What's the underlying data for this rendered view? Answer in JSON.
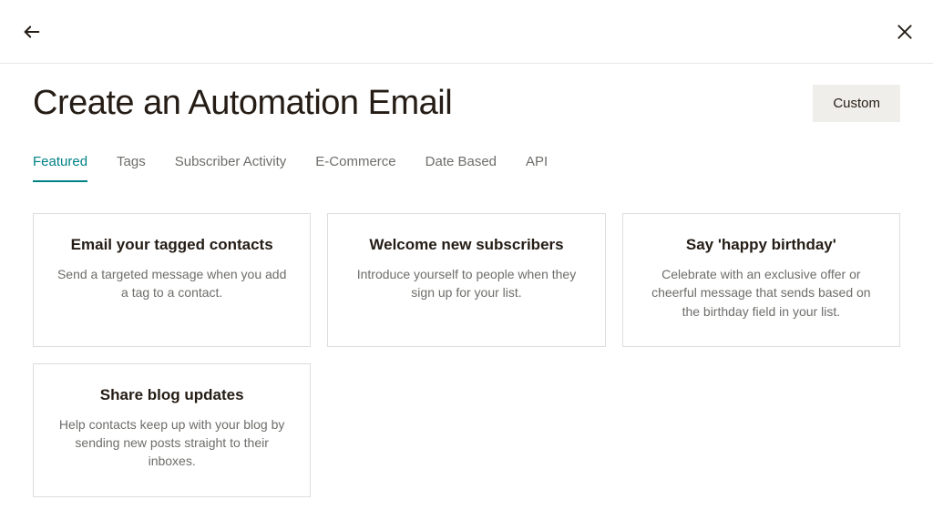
{
  "header": {
    "title": "Create an Automation Email",
    "custom_button": "Custom"
  },
  "tabs": [
    {
      "label": "Featured",
      "active": true
    },
    {
      "label": "Tags",
      "active": false
    },
    {
      "label": "Subscriber Activity",
      "active": false
    },
    {
      "label": "E-Commerce",
      "active": false
    },
    {
      "label": "Date Based",
      "active": false
    },
    {
      "label": "API",
      "active": false
    }
  ],
  "cards": [
    {
      "title": "Email your tagged contacts",
      "description": "Send a targeted message when you add a tag to a contact."
    },
    {
      "title": "Welcome new subscribers",
      "description": "Introduce yourself to people when they sign up for your list."
    },
    {
      "title": "Say 'happy birthday'",
      "description": "Celebrate with an exclusive offer or cheerful message that sends based on the birthday field in your list."
    },
    {
      "title": "Share blog updates",
      "description": "Help contacts keep up with your blog by sending new posts straight to their inboxes."
    }
  ]
}
